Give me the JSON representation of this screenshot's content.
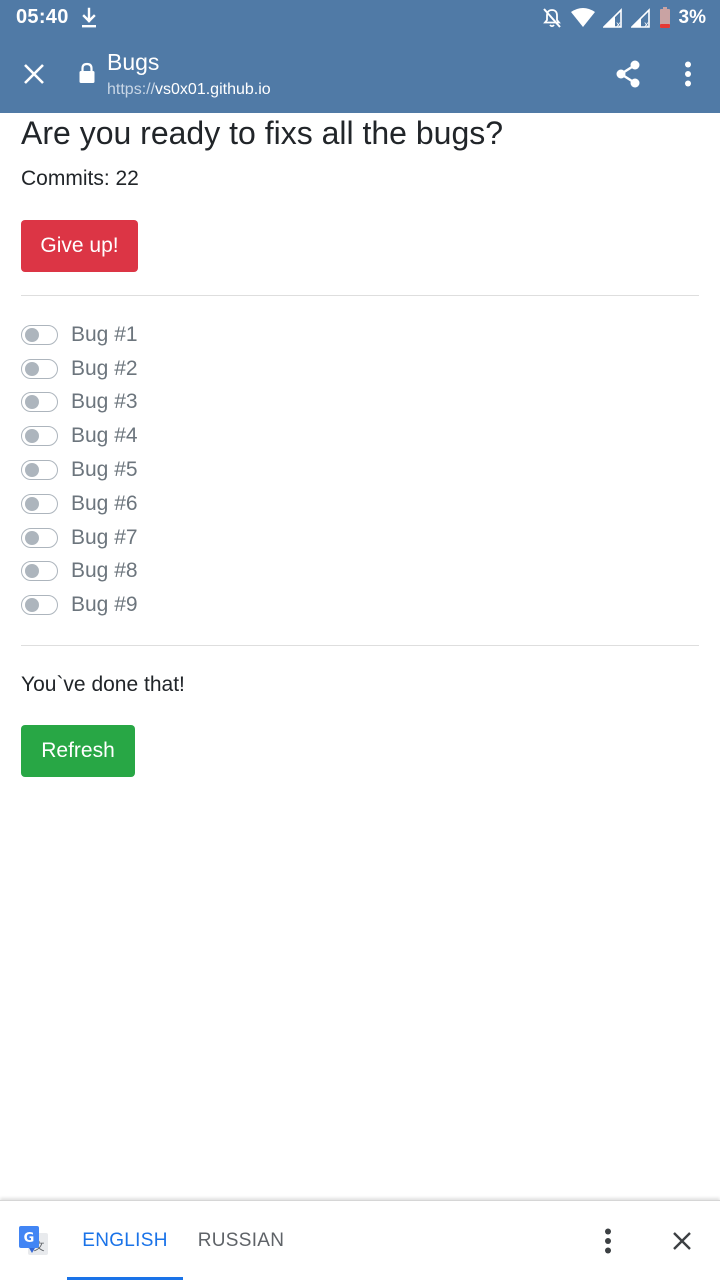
{
  "status_bar": {
    "time": "05:40",
    "battery_percent": "3%",
    "icons": [
      "download-icon",
      "notifications-off-icon",
      "wifi-icon",
      "signal-icon",
      "signal-icon",
      "battery-low-icon"
    ]
  },
  "browser": {
    "tab_title": "Bugs",
    "url_scheme": "https://",
    "url_host": "vs0x01.github.io",
    "icons": [
      "close-icon",
      "lock-icon",
      "share-icon",
      "more-vert-icon"
    ]
  },
  "page": {
    "title": "Are you ready to fixs all the bugs?",
    "commits": "Commits: 22",
    "give_up_label": "Give up!",
    "bugs": [
      {
        "label": "Bug #1",
        "checked": false
      },
      {
        "label": "Bug #2",
        "checked": false
      },
      {
        "label": "Bug #3",
        "checked": false
      },
      {
        "label": "Bug #4",
        "checked": false
      },
      {
        "label": "Bug #5",
        "checked": false
      },
      {
        "label": "Bug #6",
        "checked": false
      },
      {
        "label": "Bug #7",
        "checked": false
      },
      {
        "label": "Bug #8",
        "checked": false
      },
      {
        "label": "Bug #9",
        "checked": false
      }
    ],
    "done_text": "You`ve done that!",
    "refresh_label": "Refresh"
  },
  "translate_bar": {
    "languages": [
      {
        "label": "ENGLISH",
        "selected": true
      },
      {
        "label": "RUSSIAN",
        "selected": false
      }
    ],
    "icons": [
      "google-translate-icon",
      "more-vert-icon",
      "close-icon"
    ]
  },
  "colors": {
    "browser_bar": "#507aa6",
    "danger": "#dc3545",
    "success": "#28a745",
    "selected_language": "#1a73e8"
  }
}
